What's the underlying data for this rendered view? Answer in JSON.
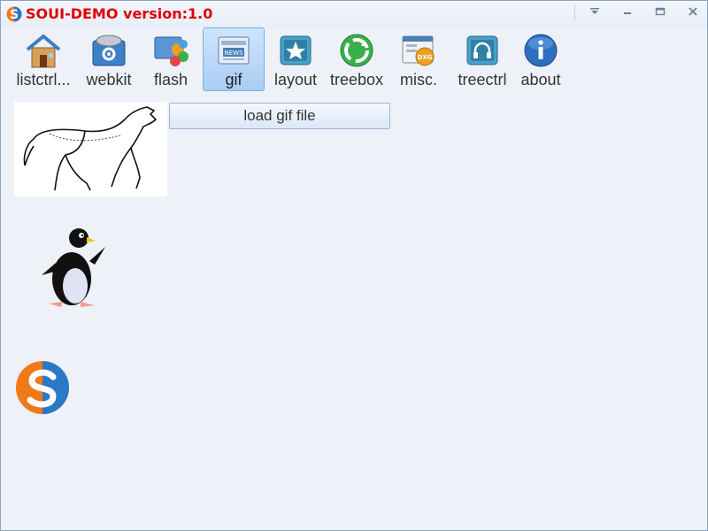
{
  "window": {
    "title": "SOUI-DEMO version:1.0",
    "title_color": "#e00000"
  },
  "titlebar": {
    "buttons": [
      {
        "name": "menu-dropdown-button",
        "icon": "dropdown-icon"
      },
      {
        "name": "minimize-button",
        "icon": "minimize-icon"
      },
      {
        "name": "maximize-button",
        "icon": "maximize-icon"
      },
      {
        "name": "close-button",
        "icon": "close-icon"
      }
    ]
  },
  "toolbar": {
    "tabs": [
      {
        "label": "listctrl...",
        "icon": "house-icon"
      },
      {
        "label": "webkit",
        "icon": "cd-gear-icon"
      },
      {
        "label": "flash",
        "icon": "monitor-circles-icon"
      },
      {
        "label": "gif",
        "icon": "news-icon",
        "active": true
      },
      {
        "label": "layout",
        "icon": "star-frame-icon"
      },
      {
        "label": "treebox",
        "icon": "recycle-icon"
      },
      {
        "label": "misc.",
        "icon": "dxg-window-icon"
      },
      {
        "label": "treectrl",
        "icon": "headphones-icon"
      },
      {
        "label": "about",
        "icon": "info-icon"
      }
    ],
    "active_bg": "#b9d7f6"
  },
  "content": {
    "load_button_label": "load gif file",
    "images": [
      "horse-animation",
      "penguin-animation",
      "soui-logo"
    ]
  }
}
